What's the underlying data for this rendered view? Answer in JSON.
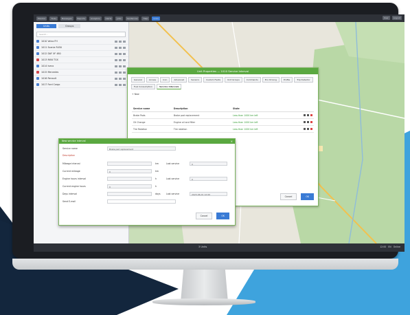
{
  "colors": {
    "brand_green": "#5aa840",
    "accent_blue": "#3a7bd5",
    "bg_navy": "#12243a",
    "bg_sky": "#3ea3dd",
    "taskbar": "#2e3138"
  },
  "taskbar": {
    "items": [
      "Monitor",
      "Tools",
      "Messages",
      "Reports",
      "Analytics",
      "Alerts",
      "Jobs",
      "Geofences",
      "Help",
      "Units"
    ],
    "active_index": 9,
    "right": [
      "User",
      "Logout"
    ]
  },
  "left_panel": {
    "tabs": [
      "Units",
      "Groups"
    ],
    "search_placeholder": "Search...",
    "rows": [
      {
        "label": "1010 Volvo FH",
        "color": "#4a7fd0"
      },
      {
        "label": "1011 Scania R450",
        "color": "#4a7fd0"
      },
      {
        "label": "1012 DAF XF 480",
        "color": "#4a7fd0"
      },
      {
        "label": "1013 MAN TGX",
        "color": "#d2474e"
      },
      {
        "label": "1014 Iveco",
        "color": "#4a7fd0"
      },
      {
        "label": "1015 Mercedes",
        "color": "#d2474e"
      },
      {
        "label": "1016 Renault",
        "color": "#4a7fd0"
      },
      {
        "label": "1017 Ford Cargo",
        "color": "#4a7fd0"
      }
    ]
  },
  "dialog": {
    "title": "Unit Properties — 1010 Service Interval",
    "tabs": [
      "General",
      "Access",
      "Icon",
      "Advanced",
      "Sensors",
      "Custom Fields",
      "Unit Groups",
      "Commands",
      "Eco Driving",
      "Profile",
      "Trip Detector",
      "Fuel Consumption",
      "Service Intervals"
    ],
    "active_tab": "Service Intervals",
    "add_link": "+ New",
    "columns": [
      "Service name",
      "Description",
      "State"
    ],
    "rows": [
      {
        "name": "Brake Pads",
        "description": "Brake pad replacement",
        "state": "Less than 1000 km left"
      },
      {
        "name": "Oil Change",
        "description": "Engine oil and filter",
        "state": "Less than 1000 km left"
      },
      {
        "name": "Tire Rotation",
        "description": "Tire rotation",
        "state": "Less than 1000 km left"
      }
    ],
    "buttons": {
      "cancel": "Cancel",
      "ok": "OK"
    }
  },
  "subdialog": {
    "title": "New service interval",
    "fields": {
      "service_name": {
        "label": "Service name",
        "value": "Brake pad replacement"
      },
      "description": {
        "label": "Description"
      },
      "mileage_interval": {
        "label": "Mileage interval",
        "value": "",
        "unit": "km",
        "last_label": "Last service",
        "last_value": "0"
      },
      "current_mileage": {
        "label": "Current mileage",
        "value": "0",
        "unit": "km"
      },
      "engine_hours_interval": {
        "label": "Engine hours interval",
        "value": "",
        "unit": "h",
        "last_label": "Last service",
        "last_value": "0"
      },
      "current_engine_hours": {
        "label": "Current engine hours",
        "value": "0",
        "unit": "h"
      },
      "days_interval": {
        "label": "Days interval",
        "value": "",
        "unit": "days",
        "last_label": "Last service",
        "last_value": "2023-06-01 12:00"
      },
      "send_email": {
        "label": "Send E-mail",
        "value": ""
      }
    },
    "buttons": {
      "cancel": "Cancel",
      "ok": "OK"
    }
  },
  "bottom_bar": {
    "label": "3 Units",
    "right": [
      "12:00",
      "EN",
      "Online"
    ]
  }
}
